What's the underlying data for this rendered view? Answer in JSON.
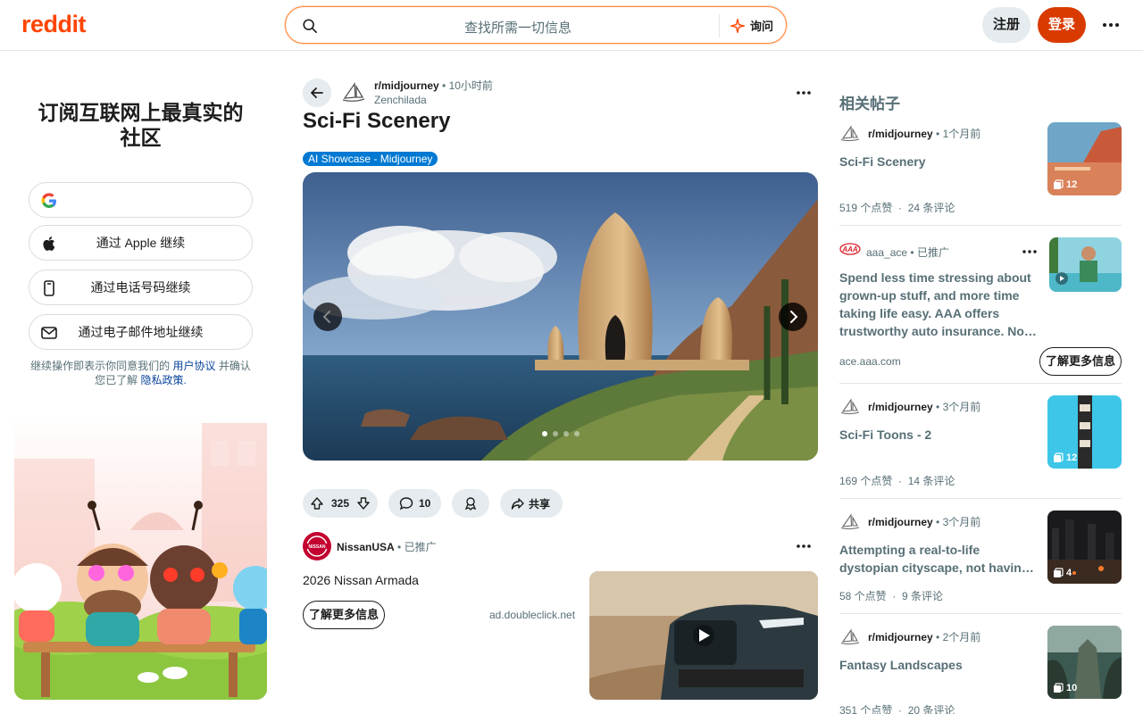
{
  "header": {
    "logo": "reddit",
    "search_placeholder": "查找所需一切信息",
    "ask_label": "询问",
    "signup_label": "注册",
    "login_label": "登录"
  },
  "left": {
    "title": "订阅互联网上最真实的社区",
    "apple_label": "通过 Apple 继续",
    "phone_label": "通过电话号码继续",
    "email_label": "通过电子邮件地址继续",
    "legal_prefix": "继续操作即表示你同意我们的",
    "legal_terms": "用户协议",
    "legal_mid": "并确认您已了解",
    "legal_privacy": "隐私政策",
    "legal_suffix": "."
  },
  "post": {
    "subreddit": "r/midjourney",
    "time": "10小时前",
    "author": "Zenchilada",
    "title": "Sci-Fi Scenery",
    "flair": "AI Showcase - Midjourney",
    "votes": "325",
    "comments": "10",
    "share_label": "共享"
  },
  "ad": {
    "advertiser": "NissanUSA",
    "avatar_text": "NISSAN",
    "promoted": "已推广",
    "text": "2026 Nissan Armada",
    "cta": "了解更多信息",
    "domain": "ad.doubleclick.net"
  },
  "related": {
    "title": "相关帖子",
    "items": [
      {
        "sub": "r/midjourney",
        "time": "1个月前",
        "title": "Sci-Fi Scenery",
        "likes": "519 个点赞",
        "comments": "24 条评论",
        "count": "12"
      },
      {
        "sub": "aaa_ace",
        "time": "已推广",
        "title": "Spend less time stressing about grown-up stuff, and more time taking life easy. AAA offers trustworthy auto insurance. No…",
        "domain": "ace.aaa.com",
        "cta": "了解更多信息"
      },
      {
        "sub": "r/midjourney",
        "time": "3个月前",
        "title": "Sci-Fi Toons - 2",
        "likes": "169 个点赞",
        "comments": "14 条评论",
        "count": "12"
      },
      {
        "sub": "r/midjourney",
        "time": "3个月前",
        "title": "Attempting a real-to-life dystopian cityscape, not havin…",
        "likes": "58 个点赞",
        "comments": "9 条评论",
        "count": "4"
      },
      {
        "sub": "r/midjourney",
        "time": "2个月前",
        "title": "Fantasy Landscapes",
        "likes": "351 个点赞",
        "comments": "20 条评论",
        "count": "10"
      }
    ]
  },
  "colors": {
    "brand": "#ff4500",
    "login": "#d93a00",
    "flair": "#0079d3",
    "link": "#0a449b"
  }
}
